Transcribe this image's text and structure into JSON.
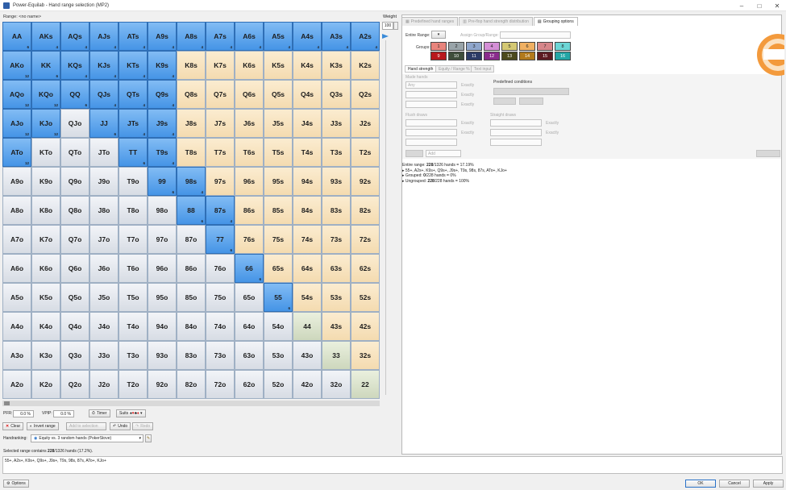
{
  "window": {
    "title": "Power-Equilab - Hand range selection (MP2)",
    "minimize": "–",
    "maximize": "□",
    "close": "✕"
  },
  "range": {
    "label": "Range: <no name>"
  },
  "matrix": {
    "rows": [
      [
        {
          "l": "AA",
          "c": "6",
          "s": 1
        },
        {
          "l": "AKs",
          "c": "4",
          "s": 1
        },
        {
          "l": "AQs",
          "c": "4",
          "s": 1
        },
        {
          "l": "AJs",
          "c": "4",
          "s": 1
        },
        {
          "l": "ATs",
          "c": "4",
          "s": 1
        },
        {
          "l": "A9s",
          "c": "4",
          "s": 1
        },
        {
          "l": "A8s",
          "c": "4",
          "s": 1
        },
        {
          "l": "A7s",
          "c": "4",
          "s": 1
        },
        {
          "l": "A6s",
          "c": "4",
          "s": 1
        },
        {
          "l": "A5s",
          "c": "4",
          "s": 1
        },
        {
          "l": "A4s",
          "c": "4",
          "s": 1
        },
        {
          "l": "A3s",
          "c": "4",
          "s": 1
        },
        {
          "l": "A2s",
          "c": "4",
          "s": 1
        }
      ],
      [
        {
          "l": "AKo",
          "c": "12",
          "s": 1
        },
        {
          "l": "KK",
          "c": "6",
          "s": 1
        },
        {
          "l": "KQs",
          "c": "4",
          "s": 1
        },
        {
          "l": "KJs",
          "c": "4",
          "s": 1
        },
        {
          "l": "KTs",
          "c": "4",
          "s": 1
        },
        {
          "l": "K9s",
          "c": "4",
          "s": 1
        },
        {
          "l": "K8s",
          "c": "",
          "s": 0
        },
        {
          "l": "K7s",
          "c": "",
          "s": 0
        },
        {
          "l": "K6s",
          "c": "",
          "s": 0
        },
        {
          "l": "K5s",
          "c": "",
          "s": 0
        },
        {
          "l": "K4s",
          "c": "",
          "s": 0
        },
        {
          "l": "K3s",
          "c": "",
          "s": 0
        },
        {
          "l": "K2s",
          "c": "",
          "s": 0
        }
      ],
      [
        {
          "l": "AQo",
          "c": "12",
          "s": 1
        },
        {
          "l": "KQo",
          "c": "12",
          "s": 1
        },
        {
          "l": "QQ",
          "c": "6",
          "s": 1
        },
        {
          "l": "QJs",
          "c": "4",
          "s": 1
        },
        {
          "l": "QTs",
          "c": "4",
          "s": 1
        },
        {
          "l": "Q9s",
          "c": "4",
          "s": 1
        },
        {
          "l": "Q8s",
          "c": "",
          "s": 0
        },
        {
          "l": "Q7s",
          "c": "",
          "s": 0
        },
        {
          "l": "Q6s",
          "c": "",
          "s": 0
        },
        {
          "l": "Q5s",
          "c": "",
          "s": 0
        },
        {
          "l": "Q4s",
          "c": "",
          "s": 0
        },
        {
          "l": "Q3s",
          "c": "",
          "s": 0
        },
        {
          "l": "Q2s",
          "c": "",
          "s": 0
        }
      ],
      [
        {
          "l": "AJo",
          "c": "12",
          "s": 1
        },
        {
          "l": "KJo",
          "c": "12",
          "s": 1
        },
        {
          "l": "QJo",
          "c": "",
          "s": 0
        },
        {
          "l": "JJ",
          "c": "6",
          "s": 1
        },
        {
          "l": "JTs",
          "c": "4",
          "s": 1
        },
        {
          "l": "J9s",
          "c": "4",
          "s": 1
        },
        {
          "l": "J8s",
          "c": "",
          "s": 0
        },
        {
          "l": "J7s",
          "c": "",
          "s": 0
        },
        {
          "l": "J6s",
          "c": "",
          "s": 0
        },
        {
          "l": "J5s",
          "c": "",
          "s": 0
        },
        {
          "l": "J4s",
          "c": "",
          "s": 0
        },
        {
          "l": "J3s",
          "c": "",
          "s": 0
        },
        {
          "l": "J2s",
          "c": "",
          "s": 0
        }
      ],
      [
        {
          "l": "ATo",
          "c": "12",
          "s": 1
        },
        {
          "l": "KTo",
          "c": "",
          "s": 0
        },
        {
          "l": "QTo",
          "c": "",
          "s": 0
        },
        {
          "l": "JTo",
          "c": "",
          "s": 0
        },
        {
          "l": "TT",
          "c": "6",
          "s": 1
        },
        {
          "l": "T9s",
          "c": "4",
          "s": 1
        },
        {
          "l": "T8s",
          "c": "",
          "s": 0
        },
        {
          "l": "T7s",
          "c": "",
          "s": 0
        },
        {
          "l": "T6s",
          "c": "",
          "s": 0
        },
        {
          "l": "T5s",
          "c": "",
          "s": 0
        },
        {
          "l": "T4s",
          "c": "",
          "s": 0
        },
        {
          "l": "T3s",
          "c": "",
          "s": 0
        },
        {
          "l": "T2s",
          "c": "",
          "s": 0
        }
      ],
      [
        {
          "l": "A9o",
          "c": "",
          "s": 0
        },
        {
          "l": "K9o",
          "c": "",
          "s": 0
        },
        {
          "l": "Q9o",
          "c": "",
          "s": 0
        },
        {
          "l": "J9o",
          "c": "",
          "s": 0
        },
        {
          "l": "T9o",
          "c": "",
          "s": 0
        },
        {
          "l": "99",
          "c": "6",
          "s": 1
        },
        {
          "l": "98s",
          "c": "4",
          "s": 1
        },
        {
          "l": "97s",
          "c": "",
          "s": 0
        },
        {
          "l": "96s",
          "c": "",
          "s": 0
        },
        {
          "l": "95s",
          "c": "",
          "s": 0
        },
        {
          "l": "94s",
          "c": "",
          "s": 0
        },
        {
          "l": "93s",
          "c": "",
          "s": 0
        },
        {
          "l": "92s",
          "c": "",
          "s": 0
        }
      ],
      [
        {
          "l": "A8o",
          "c": "",
          "s": 0
        },
        {
          "l": "K8o",
          "c": "",
          "s": 0
        },
        {
          "l": "Q8o",
          "c": "",
          "s": 0
        },
        {
          "l": "J8o",
          "c": "",
          "s": 0
        },
        {
          "l": "T8o",
          "c": "",
          "s": 0
        },
        {
          "l": "98o",
          "c": "",
          "s": 0
        },
        {
          "l": "88",
          "c": "6",
          "s": 1
        },
        {
          "l": "87s",
          "c": "4",
          "s": 1
        },
        {
          "l": "86s",
          "c": "",
          "s": 0
        },
        {
          "l": "85s",
          "c": "",
          "s": 0
        },
        {
          "l": "84s",
          "c": "",
          "s": 0
        },
        {
          "l": "83s",
          "c": "",
          "s": 0
        },
        {
          "l": "82s",
          "c": "",
          "s": 0
        }
      ],
      [
        {
          "l": "A7o",
          "c": "",
          "s": 0
        },
        {
          "l": "K7o",
          "c": "",
          "s": 0
        },
        {
          "l": "Q7o",
          "c": "",
          "s": 0
        },
        {
          "l": "J7o",
          "c": "",
          "s": 0
        },
        {
          "l": "T7o",
          "c": "",
          "s": 0
        },
        {
          "l": "97o",
          "c": "",
          "s": 0
        },
        {
          "l": "87o",
          "c": "",
          "s": 0
        },
        {
          "l": "77",
          "c": "6",
          "s": 1
        },
        {
          "l": "76s",
          "c": "",
          "s": 0
        },
        {
          "l": "75s",
          "c": "",
          "s": 0
        },
        {
          "l": "74s",
          "c": "",
          "s": 0
        },
        {
          "l": "73s",
          "c": "",
          "s": 0
        },
        {
          "l": "72s",
          "c": "",
          "s": 0
        }
      ],
      [
        {
          "l": "A6o",
          "c": "",
          "s": 0
        },
        {
          "l": "K6o",
          "c": "",
          "s": 0
        },
        {
          "l": "Q6o",
          "c": "",
          "s": 0
        },
        {
          "l": "J6o",
          "c": "",
          "s": 0
        },
        {
          "l": "T6o",
          "c": "",
          "s": 0
        },
        {
          "l": "96o",
          "c": "",
          "s": 0
        },
        {
          "l": "86o",
          "c": "",
          "s": 0
        },
        {
          "l": "76o",
          "c": "",
          "s": 0
        },
        {
          "l": "66",
          "c": "6",
          "s": 1
        },
        {
          "l": "65s",
          "c": "",
          "s": 0
        },
        {
          "l": "64s",
          "c": "",
          "s": 0
        },
        {
          "l": "63s",
          "c": "",
          "s": 0
        },
        {
          "l": "62s",
          "c": "",
          "s": 0
        }
      ],
      [
        {
          "l": "A5o",
          "c": "",
          "s": 0
        },
        {
          "l": "K5o",
          "c": "",
          "s": 0
        },
        {
          "l": "Q5o",
          "c": "",
          "s": 0
        },
        {
          "l": "J5o",
          "c": "",
          "s": 0
        },
        {
          "l": "T5o",
          "c": "",
          "s": 0
        },
        {
          "l": "95o",
          "c": "",
          "s": 0
        },
        {
          "l": "85o",
          "c": "",
          "s": 0
        },
        {
          "l": "75o",
          "c": "",
          "s": 0
        },
        {
          "l": "65o",
          "c": "",
          "s": 0
        },
        {
          "l": "55",
          "c": "6",
          "s": 1
        },
        {
          "l": "54s",
          "c": "",
          "s": 0
        },
        {
          "l": "53s",
          "c": "",
          "s": 0
        },
        {
          "l": "52s",
          "c": "",
          "s": 0
        }
      ],
      [
        {
          "l": "A4o",
          "c": "",
          "s": 0
        },
        {
          "l": "K4o",
          "c": "",
          "s": 0
        },
        {
          "l": "Q4o",
          "c": "",
          "s": 0
        },
        {
          "l": "J4o",
          "c": "",
          "s": 0
        },
        {
          "l": "T4o",
          "c": "",
          "s": 0
        },
        {
          "l": "94o",
          "c": "",
          "s": 0
        },
        {
          "l": "84o",
          "c": "",
          "s": 0
        },
        {
          "l": "74o",
          "c": "",
          "s": 0
        },
        {
          "l": "64o",
          "c": "",
          "s": 0
        },
        {
          "l": "54o",
          "c": "",
          "s": 0
        },
        {
          "l": "44",
          "c": "",
          "s": 0
        },
        {
          "l": "43s",
          "c": "",
          "s": 0
        },
        {
          "l": "42s",
          "c": "",
          "s": 0
        }
      ],
      [
        {
          "l": "A3o",
          "c": "",
          "s": 0
        },
        {
          "l": "K3o",
          "c": "",
          "s": 0
        },
        {
          "l": "Q3o",
          "c": "",
          "s": 0
        },
        {
          "l": "J3o",
          "c": "",
          "s": 0
        },
        {
          "l": "T3o",
          "c": "",
          "s": 0
        },
        {
          "l": "93o",
          "c": "",
          "s": 0
        },
        {
          "l": "83o",
          "c": "",
          "s": 0
        },
        {
          "l": "73o",
          "c": "",
          "s": 0
        },
        {
          "l": "63o",
          "c": "",
          "s": 0
        },
        {
          "l": "53o",
          "c": "",
          "s": 0
        },
        {
          "l": "43o",
          "c": "",
          "s": 0
        },
        {
          "l": "33",
          "c": "",
          "s": 0
        },
        {
          "l": "32s",
          "c": "",
          "s": 0
        }
      ],
      [
        {
          "l": "A2o",
          "c": "",
          "s": 0
        },
        {
          "l": "K2o",
          "c": "",
          "s": 0
        },
        {
          "l": "Q2o",
          "c": "",
          "s": 0
        },
        {
          "l": "J2o",
          "c": "",
          "s": 0
        },
        {
          "l": "T2o",
          "c": "",
          "s": 0
        },
        {
          "l": "92o",
          "c": "",
          "s": 0
        },
        {
          "l": "82o",
          "c": "",
          "s": 0
        },
        {
          "l": "72o",
          "c": "",
          "s": 0
        },
        {
          "l": "62o",
          "c": "",
          "s": 0
        },
        {
          "l": "52o",
          "c": "",
          "s": 0
        },
        {
          "l": "42o",
          "c": "",
          "s": 0
        },
        {
          "l": "32o",
          "c": "",
          "s": 0
        },
        {
          "l": "22",
          "c": "",
          "s": 0
        }
      ]
    ]
  },
  "weight": {
    "label": "Weight",
    "value": "100"
  },
  "controls": {
    "pfr_label": "PFR:",
    "pfr_value": "0.0 %",
    "vpip_label": "VPIP:",
    "vpip_value": "0.0 %",
    "timer_label": "Timer",
    "suits_label": "Suits",
    "clear_label": "Clear",
    "invert_label": "Invert range",
    "disabled_label": "Add to selection",
    "undo_label": "Undo",
    "redo_label": "Redo",
    "handranking_label": "Handranking:",
    "handranking_value": "Equity vs. 3 random hands (PokerStove)"
  },
  "summary": {
    "prefix": "Selected range contains ",
    "count": "228",
    "rest": "/1326 hands (17.2%)."
  },
  "range_text": "55+, A2s+, K9s+, Q9s+, J9s+, T9s, 98s, 87s, ATo+, KJo+",
  "bottom": {
    "options_label": "Options",
    "ok_label": "OK",
    "cancel_label": "Cancel",
    "apply_label": "Apply"
  },
  "tabs": [
    {
      "label": "Predefined hand ranges",
      "active": false
    },
    {
      "label": "Pre-flop hand strength distribution",
      "active": false
    },
    {
      "label": "Grouping options",
      "active": true
    }
  ],
  "grouping": {
    "entire_range_label": "Entire Range:",
    "assign_label": "Assign Group/Range:",
    "groups_label": "Groups:",
    "groups": [
      {
        "num": "1",
        "bg": "#e8847c",
        "fg": "#222"
      },
      {
        "num": "2",
        "bg": "#99a4a9",
        "fg": "#222"
      },
      {
        "num": "3",
        "bg": "#8fa6cc",
        "fg": "#222"
      },
      {
        "num": "4",
        "bg": "#d48fd6",
        "fg": "#222"
      },
      {
        "num": "5",
        "bg": "#d4c873",
        "fg": "#222"
      },
      {
        "num": "6",
        "bg": "#f0b062",
        "fg": "#222"
      },
      {
        "num": "7",
        "bg": "#d6868a",
        "fg": "#222"
      },
      {
        "num": "8",
        "bg": "#6dd6d6",
        "fg": "#222"
      },
      {
        "num": "9",
        "bg": "#b8181d",
        "fg": "#fff"
      },
      {
        "num": "10",
        "bg": "#3f4e3b",
        "fg": "#fff"
      },
      {
        "num": "11",
        "bg": "#2c3b66",
        "fg": "#fff"
      },
      {
        "num": "12",
        "bg": "#8a2c8c",
        "fg": "#fff"
      },
      {
        "num": "13",
        "bg": "#4c4a1c",
        "fg": "#fff"
      },
      {
        "num": "14",
        "bg": "#b27a1c",
        "fg": "#fff"
      },
      {
        "num": "15",
        "bg": "#5c1a22",
        "fg": "#fff"
      },
      {
        "num": "16",
        "bg": "#24a6a6",
        "fg": "#fff"
      }
    ]
  },
  "subtabs": [
    {
      "label": "Hand strength",
      "active": true
    },
    {
      "label": "Equity / Range %",
      "active": false
    },
    {
      "label": "Text input",
      "active": false
    }
  ],
  "conditions": {
    "made_hands_label": "Made hands",
    "any_label": "Any",
    "exactly_label": "Exactly",
    "flush_draws_label": "Flush draws",
    "straight_draws_label": "Straight draws",
    "predefined_label": "Predefined conditions",
    "add_label": "Add"
  },
  "results": [
    {
      "prefix": "Entire range: ",
      "bold": "228",
      "rest": "/1326 hands = 17.19%"
    },
    {
      "prefix": "▸ 55+, A2s+, K9s+, Q9s+, J9s+, T9s, 98s, 87s, ATo+, KJo+",
      "bold": "",
      "rest": ""
    },
    {
      "prefix": "▸ Grouped: ",
      "bold": "0",
      "rest": "/228 hands = 0%"
    },
    {
      "prefix": "▸ Ungrouped: ",
      "bold": "228",
      "rest": "/228 hands = 100%"
    }
  ]
}
